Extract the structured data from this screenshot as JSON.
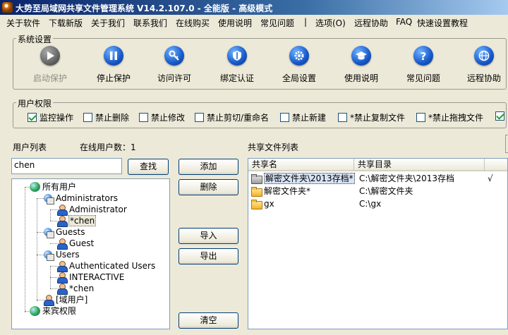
{
  "window": {
    "title": "大势至局域网共享文件管理系统 V14.2.107.0 - 全能版 - 高级模式"
  },
  "menu": [
    "关于软件",
    "下载新版",
    "关于我们",
    "联系我们",
    "在线购买",
    "使用说明",
    "常见问题",
    "|",
    "选项(O)",
    "远程协助",
    "FAQ",
    "快速设置教程"
  ],
  "system_settings": {
    "title": "系统设置",
    "tools": [
      {
        "label": "启动保护",
        "icon": "play-icon",
        "enabled": false
      },
      {
        "label": "停止保护",
        "icon": "pause-icon",
        "enabled": true
      },
      {
        "label": "访问许可",
        "icon": "key-icon",
        "enabled": true
      },
      {
        "label": "绑定认证",
        "icon": "shield-icon",
        "enabled": true
      },
      {
        "label": "全局设置",
        "icon": "gear-icon",
        "enabled": true
      },
      {
        "label": "使用说明",
        "icon": "graduation-cap-icon",
        "enabled": true
      },
      {
        "label": "常见问题",
        "icon": "question-icon",
        "enabled": true
      },
      {
        "label": "远程协助",
        "icon": "globe-icon",
        "enabled": true
      }
    ]
  },
  "permissions": {
    "title": "用户权限",
    "items": [
      {
        "label": "监控操作",
        "checked": true
      },
      {
        "label": "禁止删除",
        "checked": false
      },
      {
        "label": "禁止修改",
        "checked": false
      },
      {
        "label": "禁止剪切/重命名",
        "checked": false
      },
      {
        "label": "禁止新建",
        "checked": false
      },
      {
        "label": "*禁止复制文件",
        "checked": false
      },
      {
        "label": "*禁止拖拽文件",
        "checked": false
      },
      {
        "label": "",
        "checked": true
      }
    ]
  },
  "users": {
    "list_label": "用户列表",
    "online_label": "在线用户数：1",
    "search_value": "chen",
    "search_button": "查找",
    "tree": [
      {
        "label": "所有用户",
        "level": 0,
        "icon": "globe-icon"
      },
      {
        "label": "Administrators",
        "level": 1,
        "icon": "group-icon"
      },
      {
        "label": "Administrator",
        "level": 2,
        "icon": "user-icon"
      },
      {
        "label": "*chen",
        "level": 2,
        "icon": "user-icon",
        "selected": true
      },
      {
        "label": "Guests",
        "level": 1,
        "icon": "group-icon"
      },
      {
        "label": "Guest",
        "level": 2,
        "icon": "user-icon"
      },
      {
        "label": "Users",
        "level": 1,
        "icon": "group-icon"
      },
      {
        "label": "Authenticated Users",
        "level": 2,
        "icon": "user-icon"
      },
      {
        "label": "INTERACTIVE",
        "level": 2,
        "icon": "user-icon"
      },
      {
        "label": "*chen",
        "level": 2,
        "icon": "user-icon"
      },
      {
        "label": "[域用户]",
        "level": 1,
        "icon": "user-icon"
      },
      {
        "label": "来宾权限",
        "level": 0,
        "icon": "globe-icon"
      }
    ]
  },
  "buttons": {
    "add": "添加",
    "delete": "删除",
    "import": "导入",
    "export": "导出",
    "clear": "清空"
  },
  "shares": {
    "title": "共享文件列表",
    "columns": [
      "共享名",
      "共享目录"
    ],
    "rows": [
      {
        "name": "解密文件夹\\2013存档*",
        "path": "C:\\解密文件夹\\2013存档",
        "mark": "√",
        "icon": "locked-folder-icon",
        "selected": true
      },
      {
        "name": "解密文件夹*",
        "path": "C:\\解密文件夹",
        "mark": "",
        "icon": "folder-icon"
      },
      {
        "name": "gx",
        "path": "C:\\gx",
        "mark": "",
        "icon": "folder-icon"
      }
    ]
  }
}
